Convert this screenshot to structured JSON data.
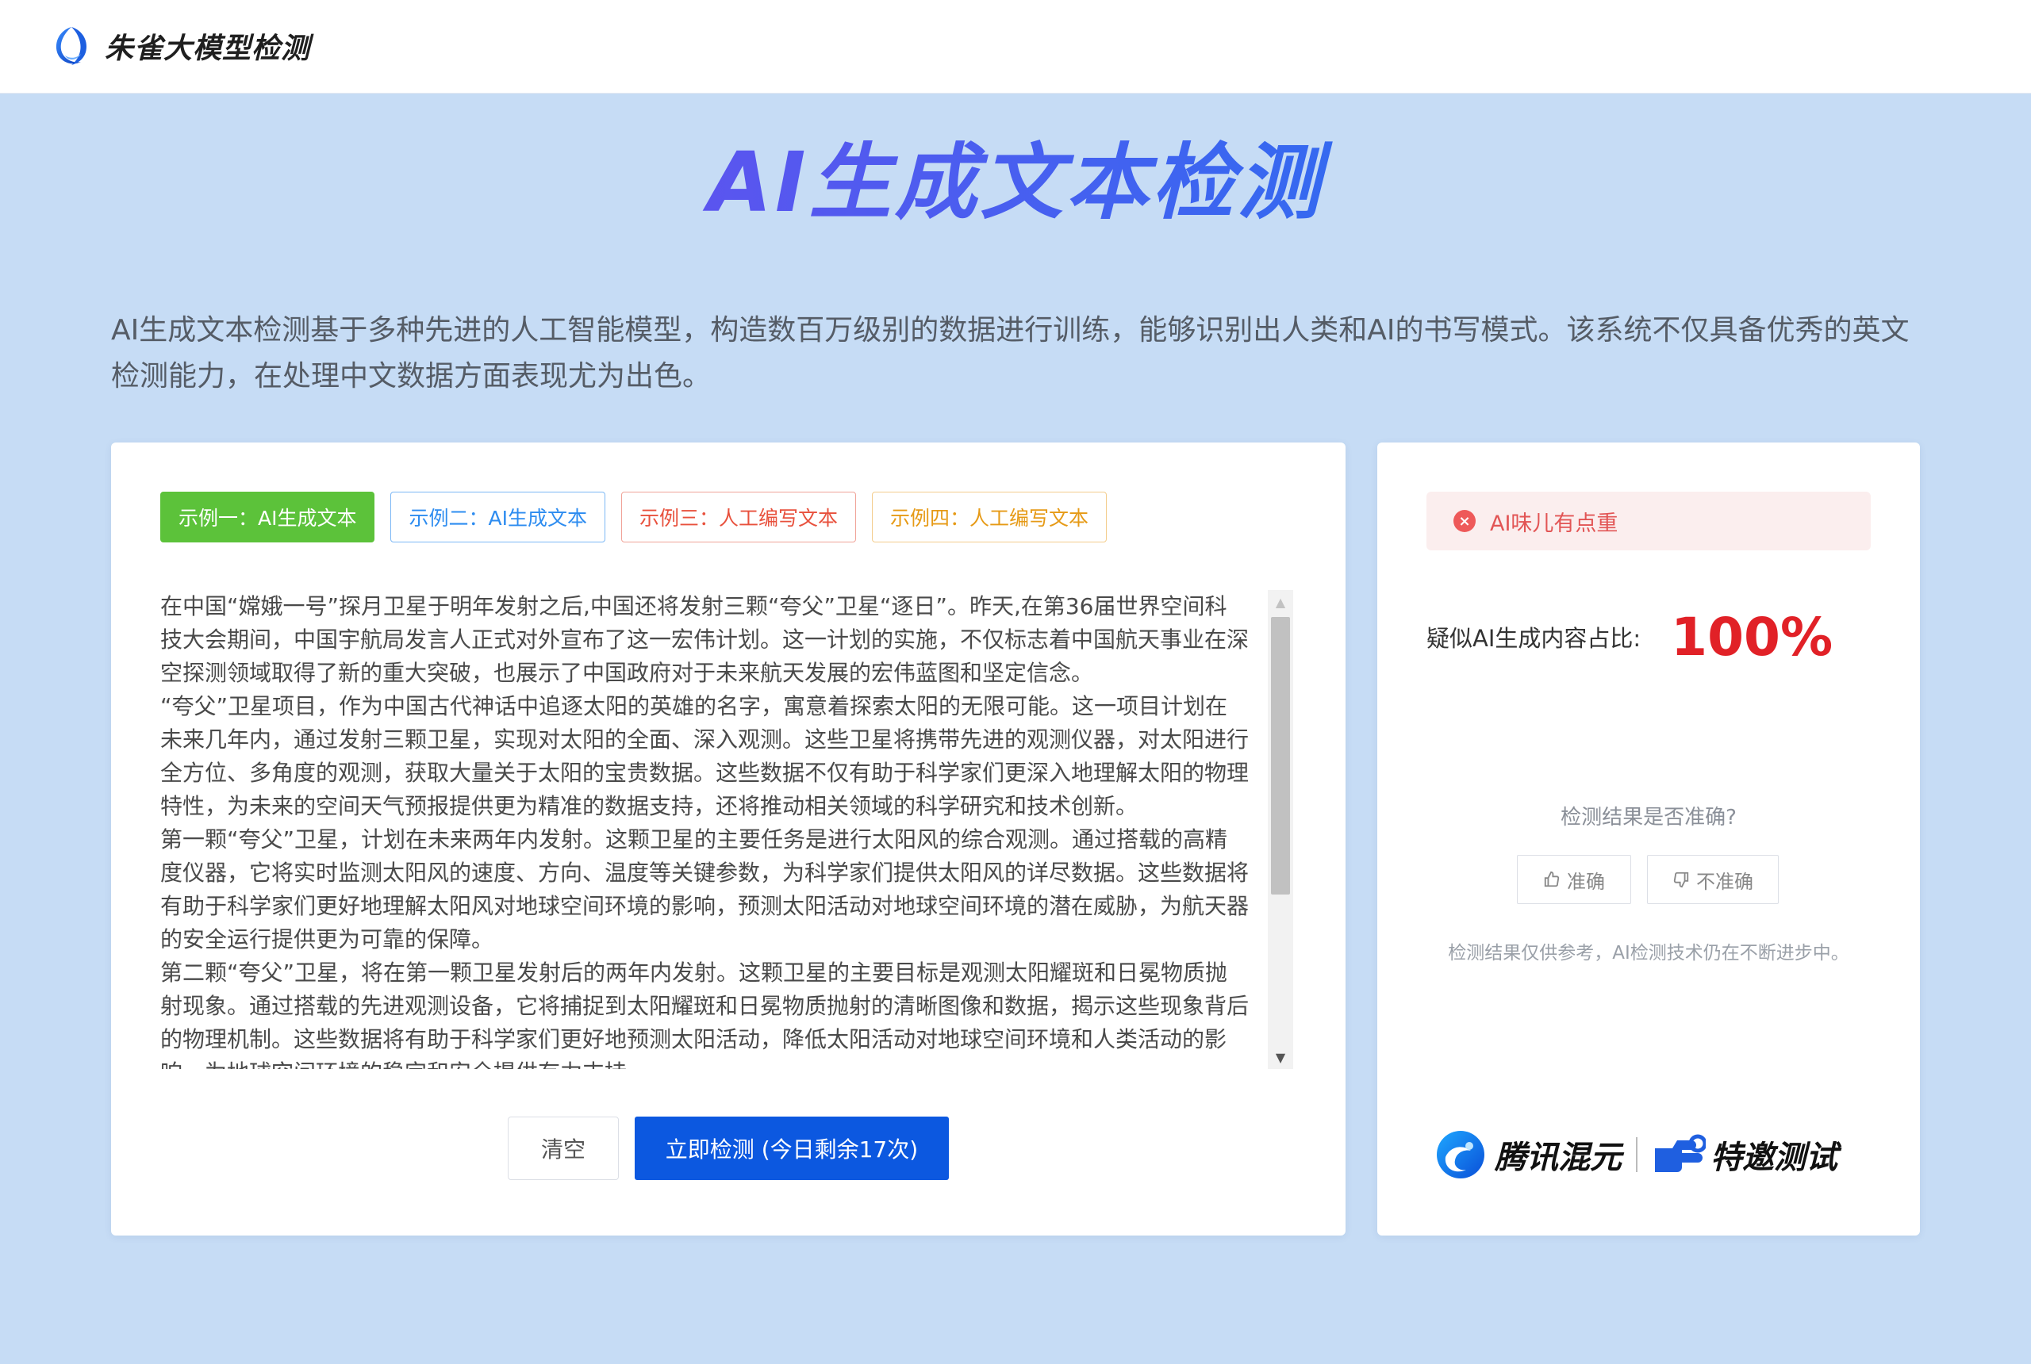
{
  "header": {
    "brand_name": "朱雀大模型检测",
    "logo_icon": "zhuque-bird-logo-icon"
  },
  "hero": {
    "title": "AI生成文本检测",
    "intro": "AI生成文本检测基于多种先进的人工智能模型，构造数百万级别的数据进行训练，能够识别出人类和AI的书写模式。该系统不仅具备优秀的英文检测能力，在处理中文数据方面表现尤为出色。"
  },
  "samples": [
    {
      "label": "示例一：AI生成文本",
      "color": "#5cc23a"
    },
    {
      "label": "示例二：AI生成文本",
      "color": "#2d8cf0"
    },
    {
      "label": "示例三：人工编写文本",
      "color": "#e8513d"
    },
    {
      "label": "示例四：人工编写文本",
      "color": "#e69a16"
    }
  ],
  "input_text": {
    "paragraphs": [
      "在中国“嫦娥一号”探月卫星于明年发射之后,中国还将发射三颗“夸父”卫星“逐日”。昨天,在第36届世界空间科技大会期间，中国宇航局发言人正式对外宣布了这一宏伟计划。这一计划的实施，不仅标志着中国航天事业在深空探测领域取得了新的重大突破，也展示了中国政府对于未来航天发展的宏伟蓝图和坚定信念。",
      "“夸父”卫星项目，作为中国古代神话中追逐太阳的英雄的名字，寓意着探索太阳的无限可能。这一项目计划在未来几年内，通过发射三颗卫星，实现对太阳的全面、深入观测。这些卫星将携带先进的观测仪器，对太阳进行全方位、多角度的观测，获取大量关于太阳的宝贵数据。这些数据不仅有助于科学家们更深入地理解太阳的物理特性，为未来的空间天气预报提供更为精准的数据支持，还将推动相关领域的科学研究和技术创新。",
      "第一颗“夸父”卫星，计划在未来两年内发射。这颗卫星的主要任务是进行太阳风的综合观测。通过搭载的高精度仪器，它将实时监测太阳风的速度、方向、温度等关键参数，为科学家们提供太阳风的详尽数据。这些数据将有助于科学家们更好地理解太阳风对地球空间环境的影响，预测太阳活动对地球空间环境的潜在威胁，为航天器的安全运行提供更为可靠的保障。",
      "第二颗“夸父”卫星，将在第一颗卫星发射后的两年内发射。这颗卫星的主要目标是观测太阳耀斑和日冕物质抛射现象。通过搭载的先进观测设备，它将捕捉到太阳耀斑和日冕物质抛射的清晰图像和数据，揭示这些现象背后的物理机制。这些数据将有助于科学家们更好地预测太阳活动，降低太阳活动对地球空间环境和人类活动的影响，为地球空间环境的稳定和安全提供有力支持。"
    ]
  },
  "actions": {
    "clear_label": "清空",
    "detect_label": "立即检测 (今日剩余17次)",
    "detect_color": "#0c58e0"
  },
  "result": {
    "alert_text": "AI味儿有点重",
    "alert_icon": "close-circle-icon",
    "ratio_label": "疑似AI生成内容占比:",
    "ratio_value": "100%",
    "ratio_color": "#e12127",
    "feedback_question": "检测结果是否准确?",
    "accurate_label": "准确",
    "inaccurate_label": "不准确",
    "disclaimer": "检测结果仅供参考，AI检测技术仍在不断进步中。",
    "partner_name": "腾讯混元",
    "partner_tag": "特邀测试"
  },
  "colors": {
    "page_bg": "#c6dcf5",
    "title_gradient_start": "#8a3ff0",
    "title_gradient_end": "#2672f0"
  }
}
